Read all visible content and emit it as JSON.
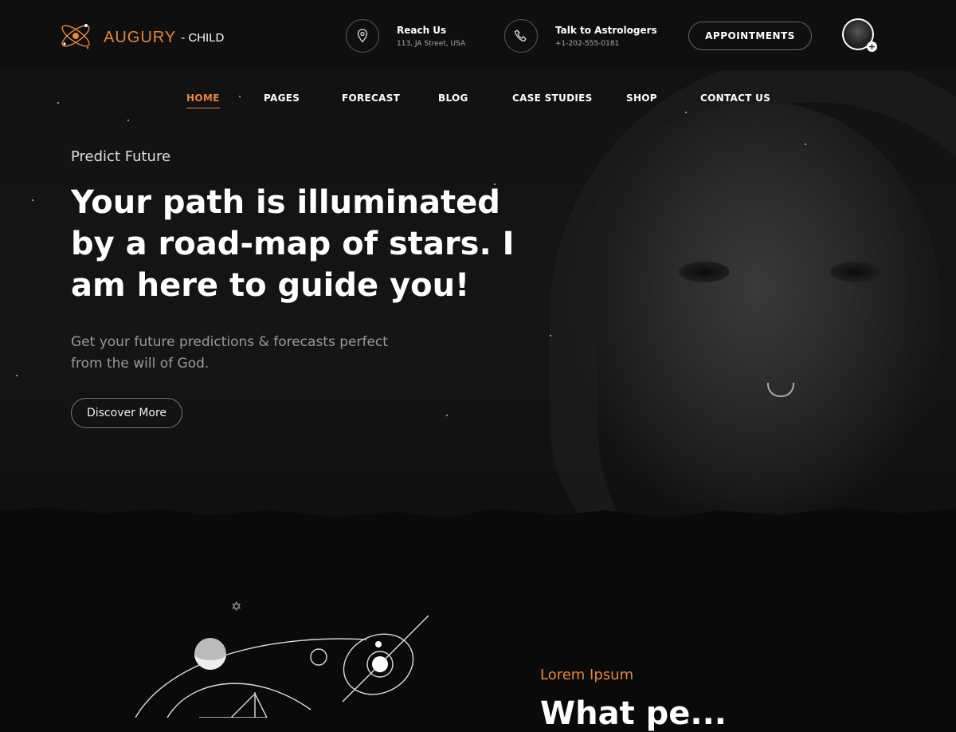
{
  "header": {
    "brand": "AUGURY",
    "brand_sub": "- CHILD",
    "reach": {
      "title": "Reach Us",
      "sub": "113, JA Street, USA"
    },
    "talk": {
      "title": "Talk to Astrologers",
      "sub": "+1-202-555-0181"
    },
    "appointments_label": "APPOINTMENTS"
  },
  "nav": {
    "items": [
      {
        "label": "HOME"
      },
      {
        "label": "PAGES"
      },
      {
        "label": "FORECAST"
      },
      {
        "label": "BLOG"
      },
      {
        "label": "CASE STUDIES"
      },
      {
        "label": "SHOP"
      },
      {
        "label": "CONTACT US"
      }
    ]
  },
  "hero": {
    "eyebrow": "Predict Future",
    "headline": "Your path is illuminated by a road-map of stars. I am here to guide you!",
    "subtext": "Get your future predictions & forecasts perfect from the will of God.",
    "cta_label": "Discover More"
  },
  "section2": {
    "eyebrow": "Lorem Ipsum",
    "heading": "What pe..."
  },
  "colors": {
    "accent": "#e8853d",
    "background": "#0a0a0a",
    "header": "#0f0f0f"
  }
}
